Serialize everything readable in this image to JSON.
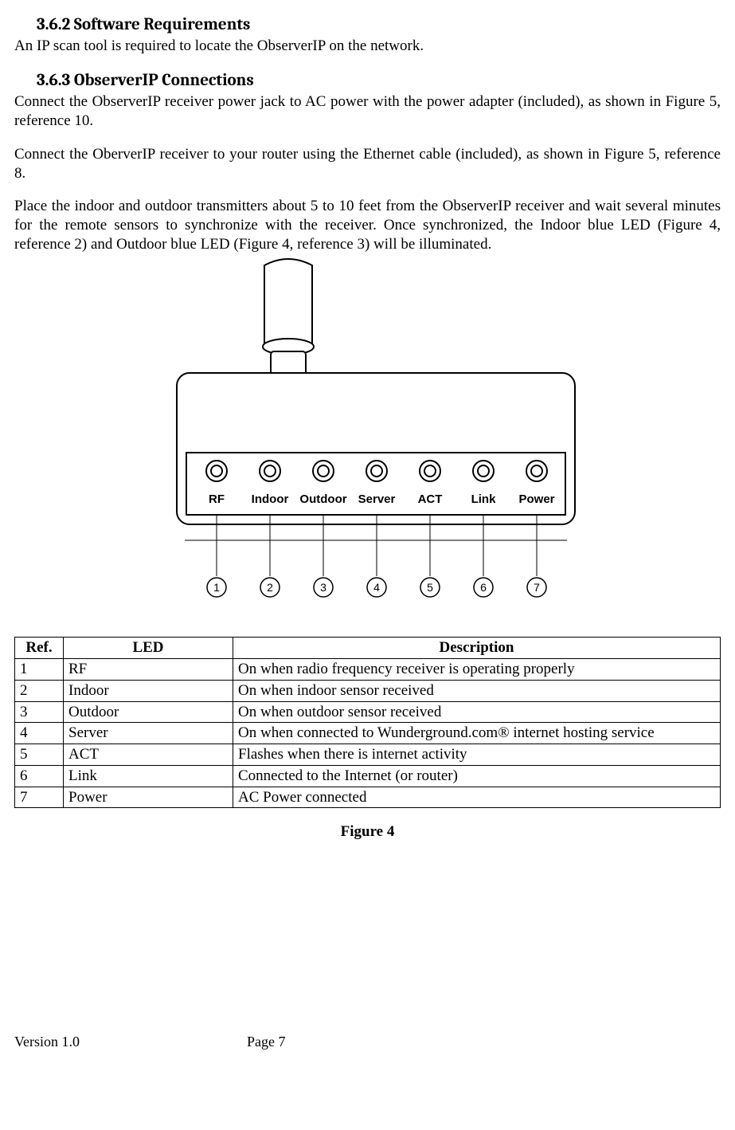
{
  "section1": {
    "heading": "3.6.2  Software Requirements",
    "p1": "An IP scan tool is required to locate the ObserverIP on the network."
  },
  "section2": {
    "heading": "3.6.3  ObserverIP Connections",
    "p1": "Connect the ObserverIP receiver power jack to AC power with the power adapter (included), as shown in Figure 5, reference 10.",
    "p2": "Connect the OberverIP receiver to your router using the Ethernet cable (included), as shown in Figure 5, reference 8.",
    "p3": "Place the indoor and outdoor transmitters about 5 to 10 feet from the ObserverIP receiver and wait several minutes for the remote sensors to synchronize with the receiver. Once synchronized, the Indoor blue LED (Figure 4, reference 2) and Outdoor blue LED (Figure 4, reference 3) will be illuminated."
  },
  "device": {
    "labels": [
      "RF",
      "Indoor",
      "Outdoor",
      "Server",
      "ACT",
      "Link",
      "Power"
    ],
    "refs": [
      "1",
      "2",
      "3",
      "4",
      "5",
      "6",
      "7"
    ]
  },
  "table": {
    "headers": {
      "ref": "Ref.",
      "led": "LED",
      "desc": "Description"
    },
    "rows": [
      {
        "ref": "1",
        "led": "RF",
        "desc": "On when radio frequency receiver is operating properly"
      },
      {
        "ref": "2",
        "led": "Indoor",
        "desc": "On when indoor sensor received"
      },
      {
        "ref": "3",
        "led": "Outdoor",
        "desc": "On when outdoor sensor received"
      },
      {
        "ref": "4",
        "led": "Server",
        "desc": "On when connected to Wunderground.com® internet hosting service"
      },
      {
        "ref": "5",
        "led": "ACT",
        "desc": "Flashes when there is internet activity"
      },
      {
        "ref": "6",
        "led": "Link",
        "desc": "Connected to the Internet (or router)"
      },
      {
        "ref": "7",
        "led": "Power",
        "desc": "AC Power connected"
      }
    ]
  },
  "figure_caption": "Figure 4",
  "footer": {
    "version": "Version 1.0",
    "page": "Page 7"
  }
}
